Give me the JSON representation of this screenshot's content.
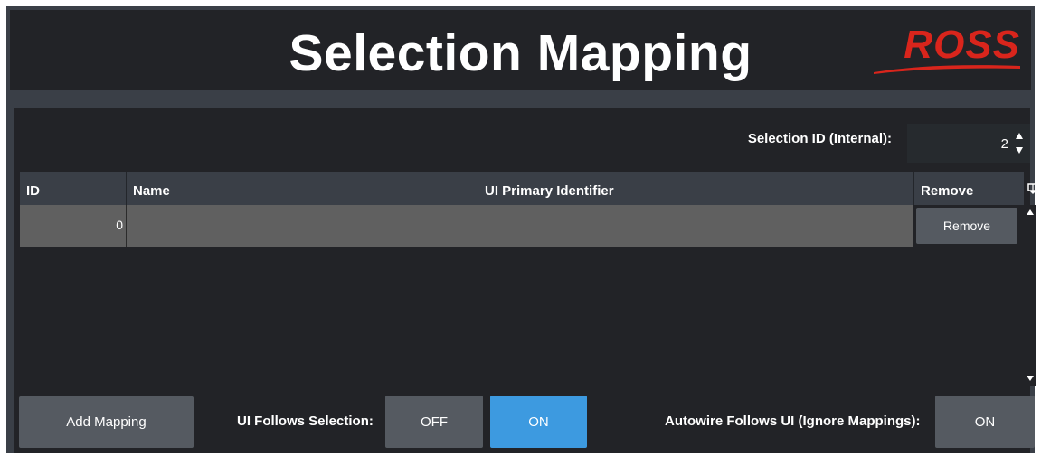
{
  "header": {
    "title": "Selection Mapping",
    "logo_text": "ROSS"
  },
  "selection_id": {
    "label": "Selection ID (Internal):",
    "value": "2"
  },
  "table": {
    "columns": [
      "ID",
      "Name",
      "UI Primary Identifier",
      "Remove"
    ],
    "rows": [
      {
        "id": "0",
        "name": "",
        "ui_primary_identifier": "",
        "remove_label": "Remove"
      }
    ]
  },
  "footer": {
    "add_mapping_label": "Add Mapping",
    "ui_follows_label": "UI Follows Selection:",
    "off_label": "OFF",
    "on_label": "ON",
    "ui_follows_state": "ON",
    "autowire_label": "Autowire Follows UI (Ignore Mappings):",
    "autowire_value": "ON"
  },
  "colors": {
    "background": "#222327",
    "frame": "#3a3f47",
    "button": "#555a61",
    "active_blue": "#3d9ae0",
    "row": "#606060",
    "logo_red": "#d9251c"
  }
}
